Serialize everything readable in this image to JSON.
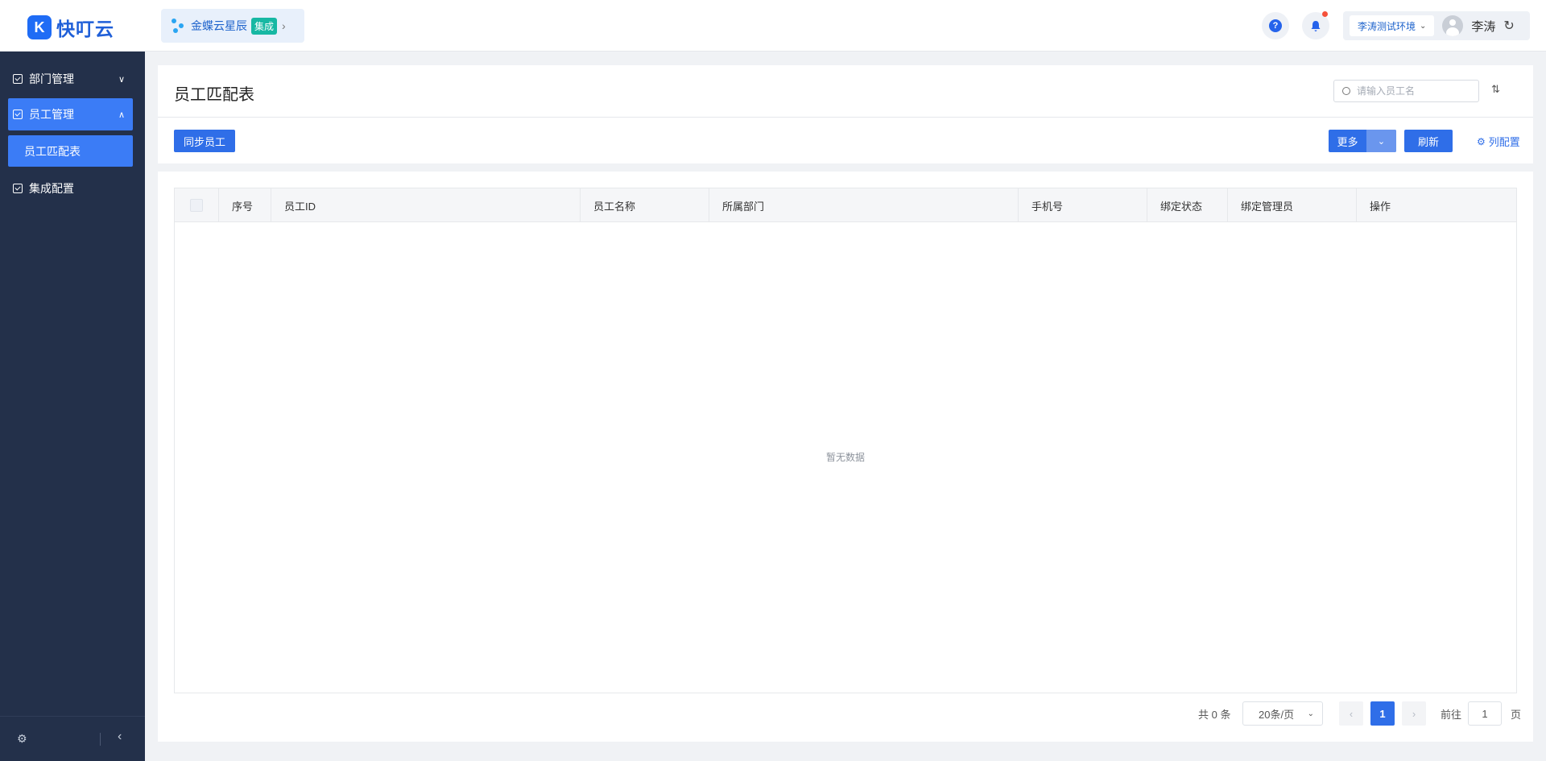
{
  "header": {
    "logo_mark": "K",
    "logo_text": "快叮云",
    "app_name": "金蝶云星辰",
    "app_badge": "集成",
    "help_symbol": "?",
    "env_selector": "李涛测试环境",
    "username": "李涛",
    "icons": [
      "help-icon",
      "bell-icon",
      "chevron-down-icon",
      "avatar",
      "refresh-icon"
    ]
  },
  "sidebar": {
    "items": [
      {
        "label": "部门管理",
        "expanded": false
      },
      {
        "label": "员工管理",
        "expanded": true,
        "children": [
          "员工匹配表"
        ]
      },
      {
        "label": "集成配置",
        "expanded": false
      }
    ],
    "footer_icons": [
      "settings-icon",
      "collapse-icon"
    ]
  },
  "page": {
    "title": "员工匹配表",
    "search_placeholder": "请输入员工名",
    "actions": {
      "sync": "同步员工",
      "more": "更多",
      "refresh": "刷新",
      "column_config": "列配置"
    }
  },
  "table": {
    "columns": [
      "序号",
      "员工ID",
      "员工名称",
      "所属部门",
      "手机号",
      "绑定状态",
      "绑定管理员",
      "操作"
    ],
    "rows": [],
    "empty_text": "暂无数据"
  },
  "pagination": {
    "total_text": "共 0 条",
    "page_size": "20条/页",
    "current_page": "1",
    "goto_label": "前往",
    "goto_value": "1",
    "page_unit": "页"
  },
  "colors": {
    "primary": "#2f6ee8",
    "sidebar_bg": "#23304a",
    "sidebar_active": "#3b7cf6",
    "badge": "#17b8a3",
    "notification_dot": "#f5513b"
  }
}
